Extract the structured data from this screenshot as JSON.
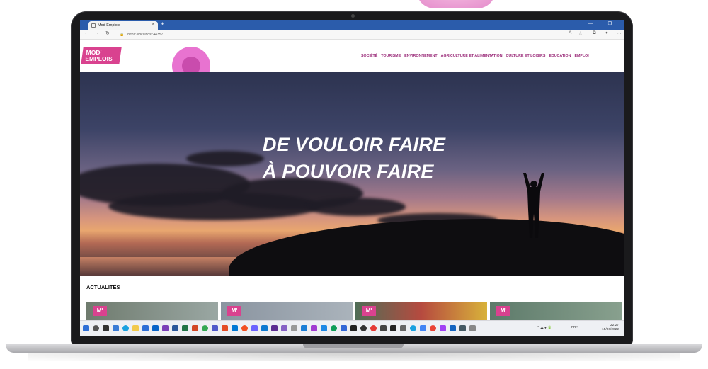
{
  "browser": {
    "tab_title": "Mod Emplois",
    "tab_close": "×",
    "new_tab": "+",
    "window_controls": "— ❐",
    "url": "https://localhost:44357"
  },
  "site": {
    "logo_line1": "MOD'",
    "logo_line2": "EMPLOIS",
    "nav": [
      "SOCIÉTÉ",
      "TOURISME",
      "ENVIRONNEMENT",
      "AGRICULTURE ET ALIMENTATION",
      "CULTURE ET LOISIRS",
      "EDUCATION",
      "EMPLOI"
    ],
    "hero_line1": "DE VOULOIR FAIRE",
    "hero_line2": "À POUVOIR FAIRE",
    "news_title": "ACTUALITÉS",
    "card_badge": "M'"
  },
  "taskbar": {
    "lang": "FRA",
    "time": "22:27",
    "date": "15/06/2022"
  },
  "colors": {
    "brand": "#d9428f",
    "nav_text": "#9b2d7a",
    "browser_bar": "#2b5cab"
  }
}
